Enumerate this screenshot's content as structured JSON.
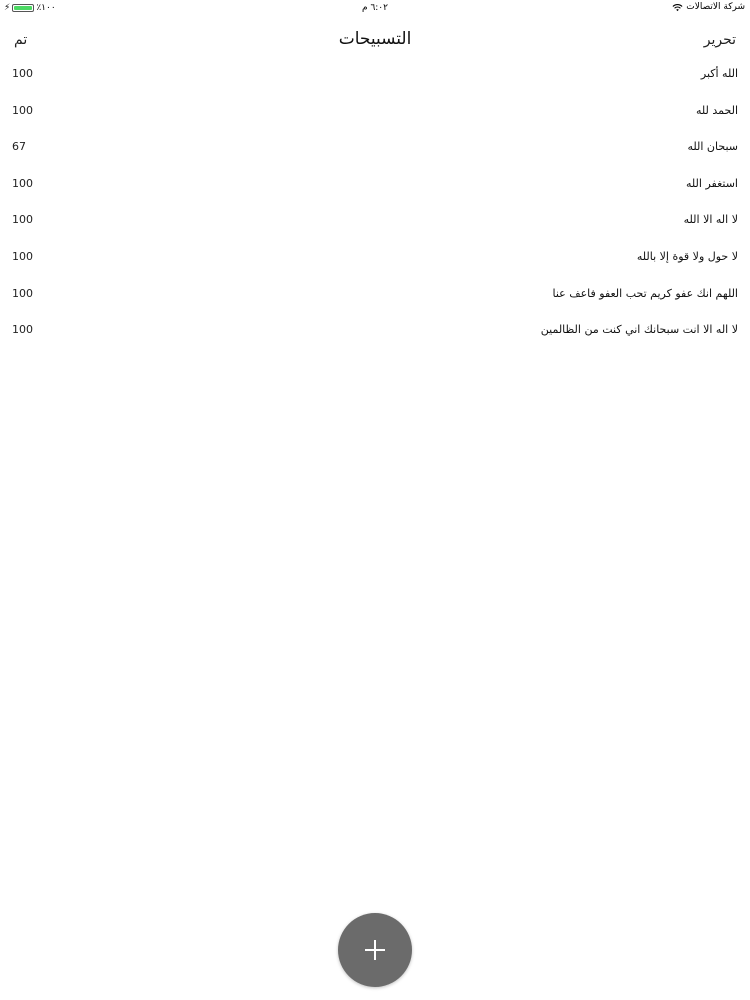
{
  "status_bar": {
    "carrier": "شركة الاتصالات",
    "time": "٦:٠٢ م",
    "battery_percent": "٪١٠٠",
    "battery_level": 1.0,
    "battery_color": "#4cd964",
    "bolt_icon": "charging-bolt-icon",
    "wifi_icon": "wifi-icon"
  },
  "nav": {
    "title": "التسبيحات",
    "done_label": "تم",
    "edit_label": "تحرير"
  },
  "rows": [
    {
      "text": "الله أكبر",
      "count": "100"
    },
    {
      "text": "الحمد لله",
      "count": "100"
    },
    {
      "text": "سبحان الله",
      "count": "67"
    },
    {
      "text": "استغفر الله",
      "count": "100"
    },
    {
      "text": "لا اله الا الله",
      "count": "100"
    },
    {
      "text": "لا حول ولا قوة إلا بالله",
      "count": "100"
    },
    {
      "text": "اللهم انك عفو كريم تحب العفو فاعف عنا",
      "count": "100"
    },
    {
      "text": "لا اله الا انت سبحانك اني كنت من الظالمين",
      "count": "100"
    }
  ],
  "fab": {
    "icon": "plus-icon",
    "color": "#6b6b6b"
  }
}
